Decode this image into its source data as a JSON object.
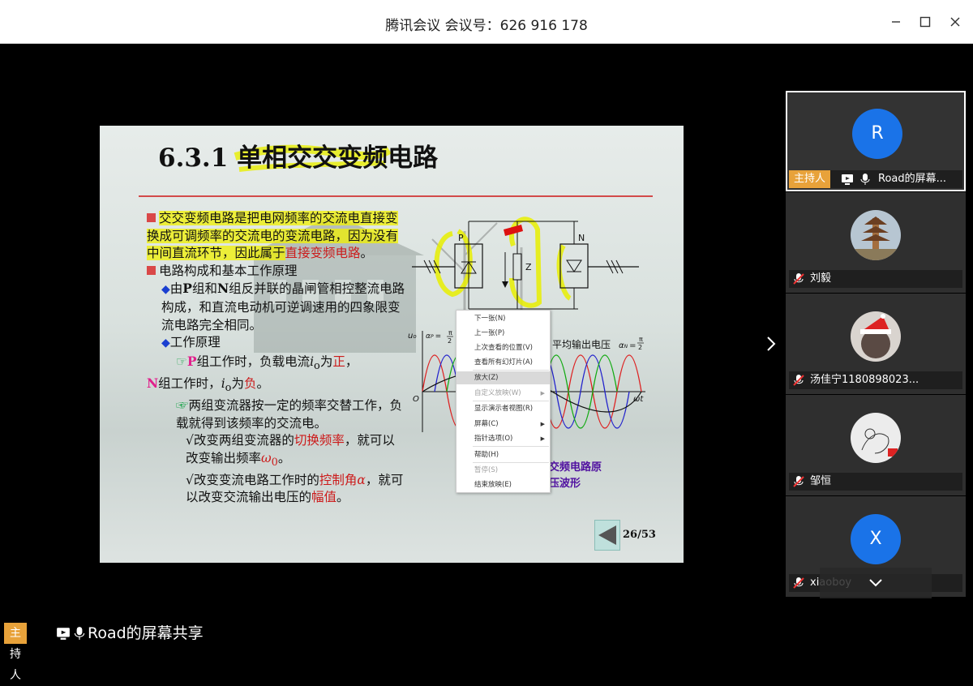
{
  "window": {
    "title": "腾讯会议 会议号：626 916 178",
    "minimize_icon": "minimize-icon",
    "maximize_icon": "maximize-icon",
    "close_icon": "close-icon"
  },
  "slide": {
    "title": "6.3.1 单相交交变频电路",
    "p1_a": "交交变频电路是把电网频率的交流电直接变换成可调频率的交流电的变流电路，因为没有中间直流环节，因此属于",
    "p1_hl": "直接变频电路",
    "p1_end": "。",
    "p2": "电路构成和基本工作原理",
    "p3_a": "由",
    "p3_P": "P",
    "p3_b": "组和",
    "p3_N": "N",
    "p3_c": "组反并联的晶闸管相控整流电路构成，和直流电动机可逆调速用的四象限变流电路完全相同。",
    "p4": "工作原理",
    "p5_P": "P",
    "p5_a": "组工作时，负载电流",
    "p5_io": "i",
    "p5_o": "o",
    "p5_b": "为",
    "p5_pos": "正",
    "p5_c": "，",
    "p6_N": "N",
    "p6_a": "组工作时，",
    "p6_io": "i",
    "p6_o": "o",
    "p6_b": "为",
    "p6_neg": "负",
    "p6_c": "。",
    "p7": "两组变流器按一定的频率交替工作，负载就得到该频率的交流电。",
    "p8_a": "√改变两组变流器的",
    "p8_hl": "切换频率",
    "p8_b": "，就可以改变输出频率",
    "p8_w": "ω",
    "p8_0": "0",
    "p8_c": "。",
    "p9_a": "√改变变流电路工作时的",
    "p9_hl": "控制角",
    "p9_alpha": "α",
    "p9_b": "，就可以改变交流输出电压的",
    "p9_hl2": "幅值",
    "p9_c": "。",
    "label_P": "P",
    "label_N": "N",
    "label_Z": "Z",
    "wave_uo": "u",
    "wave_o": "o",
    "wave_alpha_left": "α",
    "wave_P": "P",
    "wave_eq": "=",
    "wave_pi": "π",
    "wave_2": "2",
    "wave_avg": "平均输出电压",
    "wave_alpha_right": "α",
    "wave_N": "N",
    "wave_O": "O",
    "wave_wt": "ωt",
    "right_label_1": "交频电路原",
    "right_label_2": "压波形",
    "page": "26/53"
  },
  "context_menu": {
    "items": [
      {
        "label": "下一张(N)",
        "arrow": false,
        "disabled": false
      },
      {
        "label": "上一张(P)",
        "arrow": false,
        "disabled": false
      },
      {
        "label": "上次查看的位置(V)",
        "arrow": false,
        "disabled": false
      },
      {
        "label": "查看所有幻灯片(A)",
        "arrow": false,
        "disabled": false
      },
      {
        "label": "放大(Z)",
        "arrow": false,
        "disabled": false,
        "hover": true
      },
      {
        "label": "自定义放映(W)",
        "arrow": true,
        "disabled": true
      },
      {
        "label": "显示演示者视图(R)",
        "arrow": false,
        "disabled": false
      },
      {
        "label": "屏幕(C)",
        "arrow": true,
        "disabled": false
      },
      {
        "label": "指针选项(O)",
        "arrow": true,
        "disabled": false
      },
      {
        "label": "帮助(H)",
        "arrow": false,
        "disabled": false
      },
      {
        "label": "暂停(S)",
        "arrow": false,
        "disabled": true
      },
      {
        "label": "结束放映(E)",
        "arrow": false,
        "disabled": false
      }
    ]
  },
  "participants": [
    {
      "name": "Road的屏幕...",
      "avatar_letter": "R",
      "host": "主持人",
      "active": true
    },
    {
      "name": "刘毅",
      "avatar": "pagoda-avatar"
    },
    {
      "name": "汤佳宁1180898023...",
      "avatar": "santa-hat-avatar"
    },
    {
      "name": "邹恒",
      "avatar": "sketch-avatar"
    },
    {
      "name": "xiaoboy",
      "avatar_letter": "X"
    }
  ],
  "bottom": {
    "host_label": "主持人",
    "share_text": "Road的屏幕共享"
  },
  "colors": {
    "host_badge": "#e8a23a",
    "avatar_blue": "#1a73e8",
    "highlight_yellow": "#f0f000",
    "title_rule": "#d34a4a"
  }
}
